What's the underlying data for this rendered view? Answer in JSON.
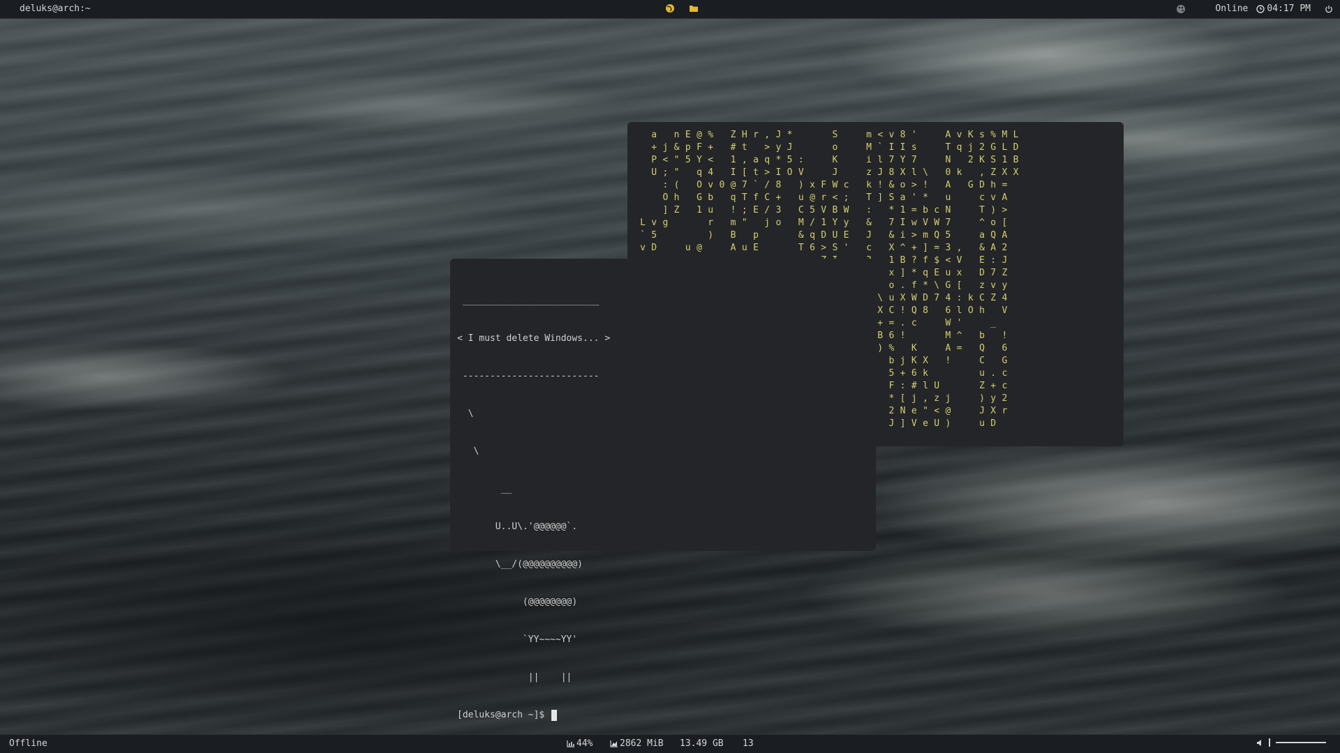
{
  "topbar": {
    "window_title": "deluks@arch:~",
    "center_icons": [
      "globe-icon",
      "folder-icon"
    ],
    "network_status": "Online",
    "clock": "04:17 PM"
  },
  "bottombar": {
    "connection_status": "Offline",
    "cpu": "44%",
    "memory": "2862 MiB",
    "disk": "13.49 GB",
    "workspace": "13",
    "volume_level": 0.95
  },
  "terminal": {
    "cowsay_top": " _________________________",
    "cowsay_msg": "< I must delete Windows... >",
    "cowsay_bottom": " -------------------------",
    "art": [
      "  \\",
      "   \\",
      "        __",
      "       U..U\\.'@@@@@@`.",
      "       \\__/(@@@@@@@@@@)",
      "            (@@@@@@@@)",
      "            `YY~~~~YY'",
      "             ||    ||"
    ],
    "prompt": "[deluks@arch ~]$ "
  },
  "matrix": {
    "color": "#d6d06a",
    "columns": [
      "\n\n\n\n\n\n\nL\n`\nv",
      "a\n+\nP\nU\n\n\n\nv\n5\nD",
      "\nj\n<\n;\n:\nO\n]\ng",
      "n\n&\n\"\n\"\n(\nh\nZ",
      "E\np\n5\n\n\n\n\n\n\nu",
      "@\nF\nY\nq\nO\nG\n1\n\n\n@",
      "%\n+\n<\n4\nv\nb\nu\nr\n)",
      "\n\n\n\n0\n\n\n\n\n",
      "Z\n#\n1\nI\n@\nq\n!\nm\nB\nA",
      "H\nt\n,\n[\n7\nT\n;\n\"\n\nu",
      "r\n\na\nt\n`\nf\nE\n\np\nE",
      ",\n>\nq\n>\n/\nC\n/\nj",
      "J\ny\n*\nI\n8\n+\n3\no",
      "*\nJ\n5\nO",
      "\n\n:\nV\n)\nu\nC\nM\n&\nT",
      "\n\n\n\nx\n@\n5\n/\nq\n6",
      "\n\n\n\nF\nr\nV\n1\nD\n>\nZ\n2\n`\nE\nj\n9\nd\nR\n&\ng\n8\nx\n\"\n]",
      "S\no\nK\nJ\nW\n<\nB\nY\nU\nS\nI\nF\n3\nY",
      "\n\n\n\nc\n;\nW\ny\nE\n'\n\n\n\n\n\n\n'\n6\nO",
      "\n\n\n\n\n\n\n\n\n\n\n\n\n\n\n\n\n@\nJ\nC\n(\n(\n/\n!",
      "m\nM\ni\nz\nk\nT\n:\n&\nJ\nc\n3\n.\nT\n!\nC\nn\n\nd\n1\nY\n_\n0\nE\n+",
      "<\n`\nl\nJ\n!\n]\n\n\n\n\n\n\n\n\\\nX\n+\nB\n)",
      "v\nI\n7\n8\n&\nS\n*\n7\n&\nX\n1\nx\no\nu\nC\n=\n6\n%\nb\n5\nF\n*\n2\nJ",
      "8\nI\nY\nX\no\na\n1\nI\ni\n^\nB\n]\n.\nX\n!\n.\n!\n\nj\n+\n:\n[\nN\n]",
      "'\ns\n7\nl\n>\n'\n=\nw\n>\n+\n?\n*\nf\nW\nQ\nc\n\nK\nK\n6\n#\nj\ne\nV",
      "\n\n\n\\\n!\n*\nb\nV\nm\n]\nf\nq\n*\nD\n8\n\n\n\nX\nk\nl\n,\n\"\ne",
      "\n\n\n\n\n\nc\nW\nQ\n=\n$\nE\n\\\n7\n\n\n\n\n\n\nU\nz\n<\nU",
      "A\nT\nN\n0\nA\nu\nN\n7\n5\n3\n<\nu\nG\n4\n6\nW\nM\nA\n!\n\n\nj\n@\n)",
      "v\nq\n\nk\n\n\n\n\n\n,\nV\nx\n[\n:\nl\n'\n^\n=",
      "K\nj\n2\n\nG\n\n\n\n\n\n\n\n\nk\nO",
      "s\n2\nK\n,\nD\nc\nT\n^\na\n&\nE\nD\nz\nC\nh\n\nb\nQ\nC\nu\nZ\n)\nJ\nu",
      "%\nG\nS\nZ\nh\nv\n)\no\nQ\nA\n:\n7\nv\nZ\n\n_\n\n\n\n.\n+\ny\nX\nD",
      "M\nL\n1\nX\n=\nA\n>\n[\nA\n2\nJ\nZ\ny\n4\nV\n\n!\n6\nG\nc\nc\n2\nr",
      "L\nD\nB\nX"
    ]
  }
}
